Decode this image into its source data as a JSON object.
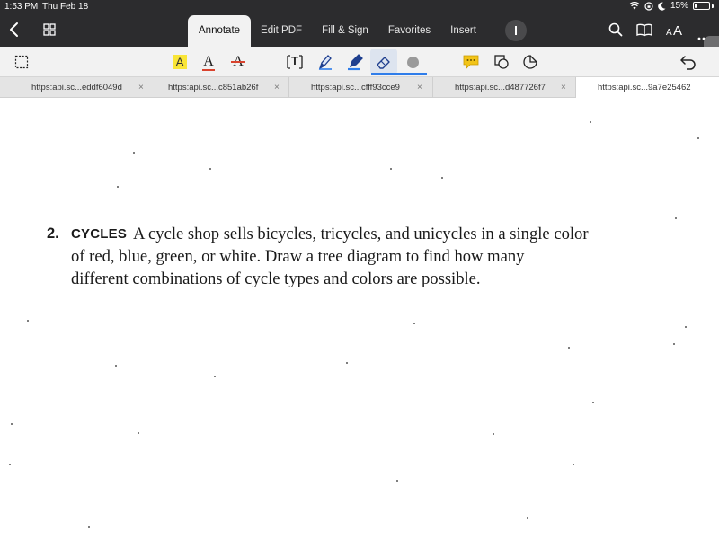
{
  "status_bar": {
    "time": "1:53 PM",
    "date": "Thu Feb 18",
    "battery": "15%",
    "battery_level": 0.15
  },
  "nav": {
    "back_icon": "chevron-left-icon",
    "grid_icon": "grid-icon"
  },
  "mode_tabs": [
    "Annotate",
    "Edit PDF",
    "Fill & Sign",
    "Favorites",
    "Insert"
  ],
  "active_mode": "Annotate",
  "header_right": {
    "text_size_label": "AA",
    "icons": [
      "search-icon",
      "book-icon",
      "text-size-icon",
      "more-icon"
    ]
  },
  "toolbar": {
    "tools": [
      "select-icon",
      "highlight-icon",
      "underline-icon",
      "strikethrough-icon",
      "text-box-icon",
      "pen-icon",
      "marker-icon",
      "eraser-icon",
      "color-dot-icon",
      "note-icon",
      "shape-icon",
      "lasso-icon",
      "undo-icon"
    ],
    "highlight_letter": "A",
    "underline_letter": "A",
    "strike_letter": "A",
    "textbox_letter": "T",
    "active_tool": "eraser",
    "colors": {
      "highlight": "#f9e537",
      "underline": "#d9432e",
      "strike": "#d9432e",
      "accent": "#2f7dea",
      "note": "#f2c418"
    }
  },
  "doc_tabs": [
    {
      "label": "https:api.sc...eddf6049d"
    },
    {
      "label": "https:api.sc...c851ab26f"
    },
    {
      "label": "https:api.sc...cfff93cce9"
    },
    {
      "label": "https:api.sc...d487726f7"
    },
    {
      "label": "https:api.sc...9a7e25462"
    }
  ],
  "close_glyph": "×",
  "document": {
    "number": "2.",
    "label": "CYCLES",
    "line1": "A cycle shop sells bicycles, tricycles, and unicycles in a single color",
    "line2": "of red, blue, green, or white. Draw a tree diagram to find how many",
    "line3": "different combinations of cycle types and colors are possible."
  }
}
